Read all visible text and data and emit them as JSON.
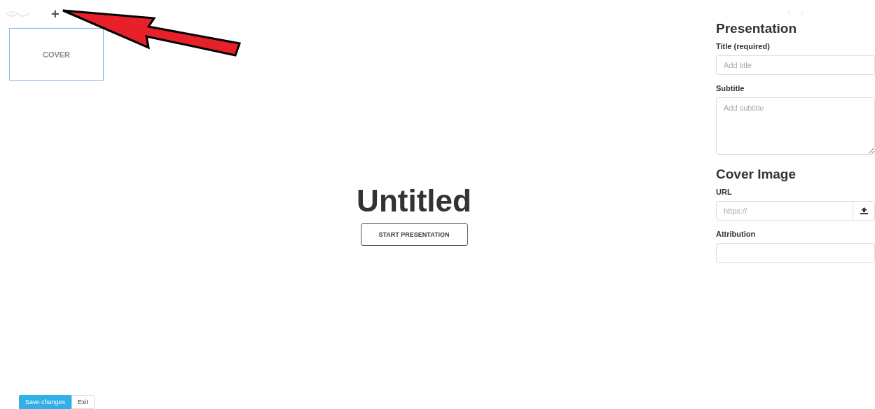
{
  "sidebar": {
    "add_label": "+",
    "slides": [
      {
        "label": "COVER",
        "selected": true
      }
    ]
  },
  "stage": {
    "title": "Untitled",
    "button": "START PRESENTATION"
  },
  "panel": {
    "heading": "Presentation",
    "fields": [
      {
        "kind": "input",
        "label": "Title (required)",
        "placeholder": "Add title"
      },
      {
        "kind": "textarea",
        "label": "Subtitle",
        "placeholder": "Add subtitle"
      }
    ],
    "section": "Cover Image",
    "image_fields": [
      {
        "kind": "upload",
        "label": "URL",
        "placeholder": "https://"
      },
      {
        "kind": "input",
        "label": "Attribution"
      }
    ]
  },
  "footer": {
    "buttons": [
      {
        "label": "Save changes",
        "kind": "primary"
      },
      {
        "label": "Exit",
        "kind": "default"
      }
    ]
  }
}
